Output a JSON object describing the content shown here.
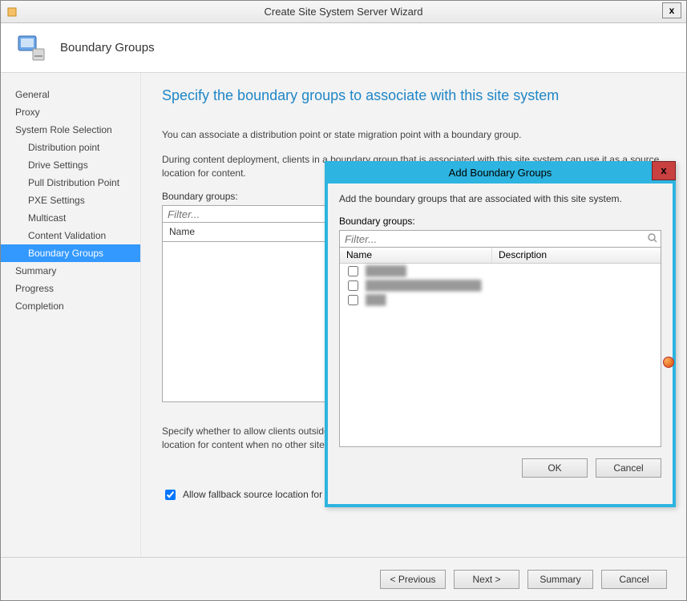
{
  "window": {
    "title": "Create Site System Server Wizard"
  },
  "header": {
    "page_name": "Boundary Groups"
  },
  "sidebar": {
    "items": [
      {
        "label": "General",
        "child": false
      },
      {
        "label": "Proxy",
        "child": false
      },
      {
        "label": "System Role Selection",
        "child": false
      },
      {
        "label": "Distribution point",
        "child": true
      },
      {
        "label": "Drive Settings",
        "child": true
      },
      {
        "label": "Pull Distribution Point",
        "child": true
      },
      {
        "label": "PXE Settings",
        "child": true
      },
      {
        "label": "Multicast",
        "child": true
      },
      {
        "label": "Content Validation",
        "child": true
      },
      {
        "label": "Boundary Groups",
        "child": true,
        "selected": true
      },
      {
        "label": "Summary",
        "child": false
      },
      {
        "label": "Progress",
        "child": false
      },
      {
        "label": "Completion",
        "child": false
      }
    ]
  },
  "main": {
    "heading": "Specify the boundary groups to associate with this site system",
    "text1": "You can associate a distribution point or state migration point with a boundary group.",
    "text2": "During content deployment, clients in a boundary group that is associated with this site system can use it as a source location for content.",
    "bg_label": "Boundary groups:",
    "filter_placeholder": "Filter...",
    "col_name": "Name",
    "para3": "Specify whether to allow clients outside these boundary groups to fall back and use this site system as a source location for content when no other site systems are available.",
    "fallback_checked": true,
    "fallback_label": "Allow fallback source location for content"
  },
  "footer": {
    "previous": "< Previous",
    "next": "Next >",
    "summary": "Summary",
    "cancel": "Cancel"
  },
  "dialog": {
    "title": "Add Boundary Groups",
    "instruction": "Add the boundary groups that are associated with this site system.",
    "bg_label": "Boundary groups:",
    "filter_placeholder": "Filter...",
    "col_name": "Name",
    "col_desc": "Description",
    "items": [
      {
        "name": "██████"
      },
      {
        "name": "█████████████████"
      },
      {
        "name": "███"
      }
    ],
    "ok": "OK",
    "cancel": "Cancel"
  }
}
